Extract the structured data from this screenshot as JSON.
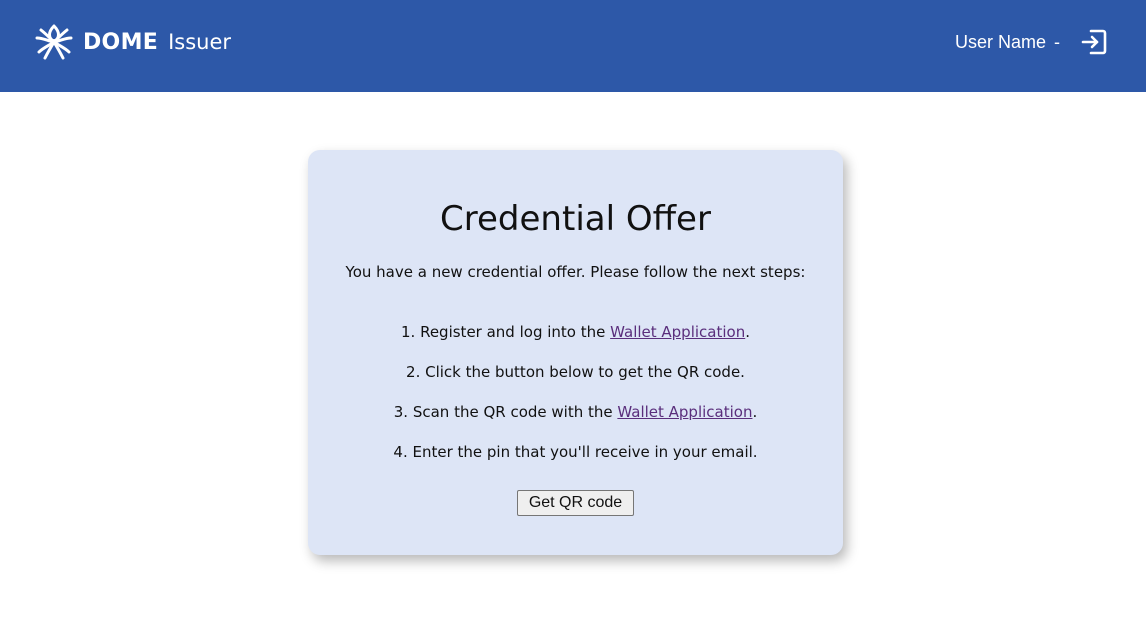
{
  "header": {
    "brand_name": "DOME",
    "brand_sub": "Issuer",
    "user_name": "User Name",
    "user_separator": "-",
    "logout_icon": "logout-icon",
    "background_color": "#2d58a8"
  },
  "card": {
    "title": "Credential Offer",
    "intro": "You have a new credential offer. Please follow the next steps:",
    "steps": [
      {
        "before": "1. Register and log into the ",
        "link": "Wallet Application",
        "after": "."
      },
      {
        "before": "2. Click the button below to get the QR code.",
        "link": "",
        "after": ""
      },
      {
        "before": "3. Scan the QR code with the ",
        "link": "Wallet Application",
        "after": "."
      },
      {
        "before": "4. Enter the pin that you'll receive in your email.",
        "link": "",
        "after": ""
      }
    ],
    "button_label": "Get QR code",
    "background_color": "#dde5f6",
    "link_color": "#5a2e7c"
  }
}
